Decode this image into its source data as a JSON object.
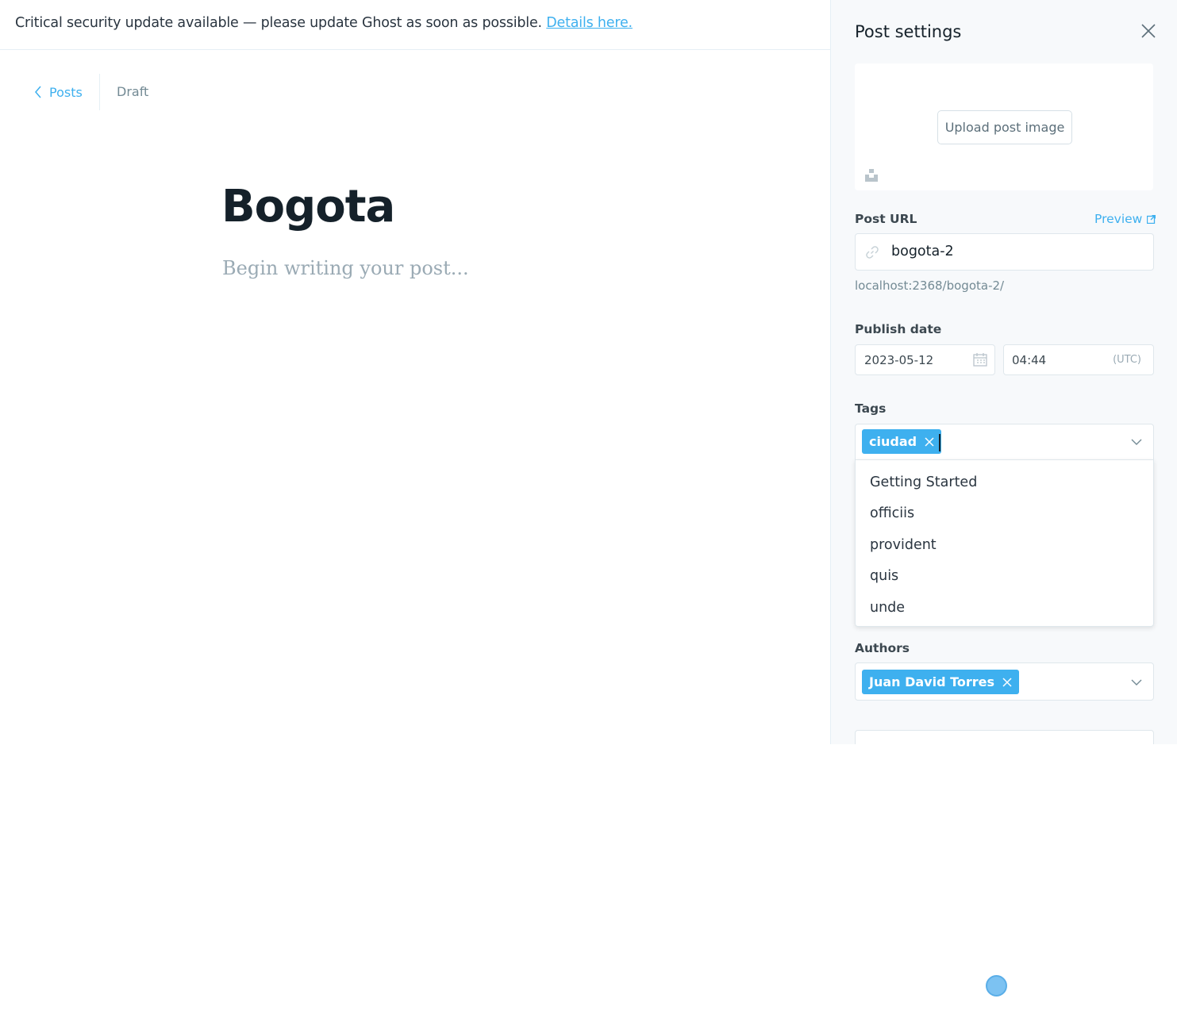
{
  "banner": {
    "message": "Critical security update available — please update Ghost as soon as possible.",
    "link_label": "Details here."
  },
  "editor": {
    "back_label": "Posts",
    "status": "Draft",
    "title": "Bogota",
    "body_placeholder": "Begin writing your post..."
  },
  "settings": {
    "title": "Post settings",
    "image": {
      "upload_label": "Upload post image"
    },
    "url": {
      "label": "Post URL",
      "preview_label": "Preview",
      "value": "bogota-2",
      "full_url": "localhost:2368/bogota-2/"
    },
    "publish": {
      "label": "Publish date",
      "date": "2023-05-12",
      "time": "04:44",
      "timezone": "(UTC)"
    },
    "tags": {
      "label": "Tags",
      "selected": [
        "ciudad"
      ],
      "options": [
        "Getting Started",
        "officiis",
        "provident",
        "quis",
        "unde"
      ]
    },
    "authors": {
      "label": "Authors",
      "selected": [
        "Juan David Torres"
      ]
    }
  },
  "colors": {
    "accent": "#3eb0ef",
    "panel_bg": "#f7f9fb",
    "text_dark": "#15212a",
    "text_muted": "#738a94"
  },
  "icons": [
    "chevron-left-icon",
    "close-icon",
    "unsplash-icon",
    "link-icon",
    "external-link-icon",
    "calendar-icon",
    "remove-tag-icon",
    "chevron-down-icon"
  ]
}
